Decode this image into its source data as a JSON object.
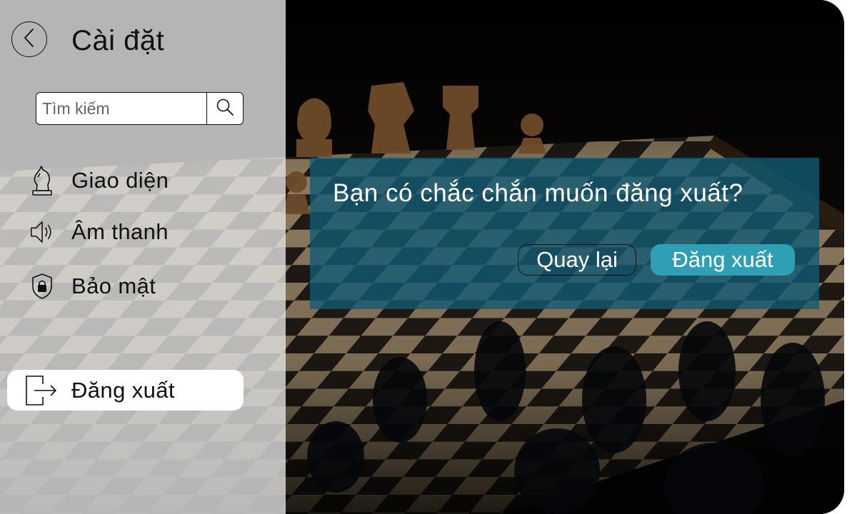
{
  "header": {
    "title": "Cài đặt"
  },
  "search": {
    "placeholder": "Tìm kiếm"
  },
  "sidebar": {
    "items": [
      {
        "label": "Giao diện",
        "icon": "chess-knight-icon"
      },
      {
        "label": "Âm thanh",
        "icon": "speaker-icon"
      },
      {
        "label": "Bảo mật",
        "icon": "shield-lock-icon"
      }
    ],
    "logout": {
      "label": "Đăng xuất",
      "icon": "logout-icon"
    }
  },
  "dialog": {
    "message": "Bạn có chắc chắn muốn đăng xuất?",
    "cancel_label": "Quay lại",
    "confirm_label": "Đăng xuất"
  },
  "colors": {
    "dialog_bg": "#125a73",
    "confirm_button": "#2f9fb6",
    "sidebar_bg": "#e2e2e2",
    "text_dark": "#111111",
    "text_light": "#ffffff"
  }
}
